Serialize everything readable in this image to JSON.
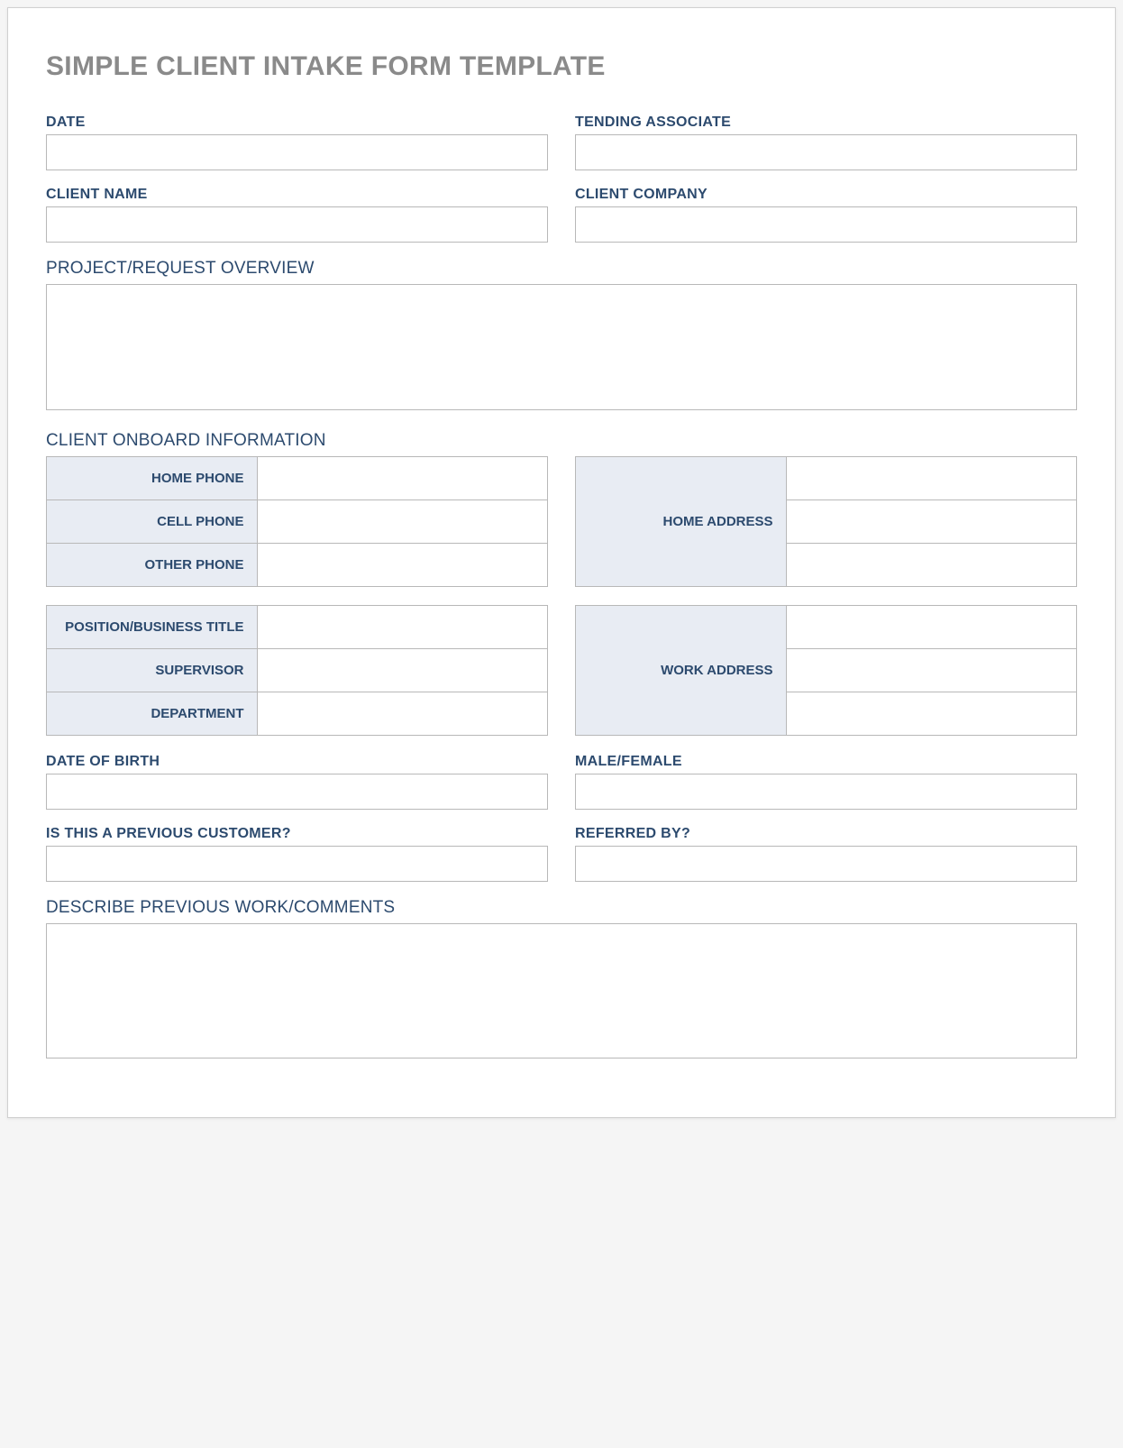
{
  "title": "SIMPLE CLIENT INTAKE FORM TEMPLATE",
  "fields": {
    "date_label": "DATE",
    "date_value": "",
    "tending_associate_label": "TENDING ASSOCIATE",
    "tending_associate_value": "",
    "client_name_label": "CLIENT NAME",
    "client_name_value": "",
    "client_company_label": "CLIENT COMPANY",
    "client_company_value": "",
    "project_overview_label": "PROJECT/REQUEST OVERVIEW",
    "project_overview_value": "",
    "onboard_section_label": "CLIENT ONBOARD INFORMATION",
    "home_phone_label": "HOME PHONE",
    "home_phone_value": "",
    "cell_phone_label": "CELL PHONE",
    "cell_phone_value": "",
    "other_phone_label": "OTHER PHONE",
    "other_phone_value": "",
    "home_address_label": "HOME ADDRESS",
    "home_address_1": "",
    "home_address_2": "",
    "home_address_3": "",
    "position_title_label": "POSITION/BUSINESS TITLE",
    "position_title_value": "",
    "supervisor_label": "SUPERVISOR",
    "supervisor_value": "",
    "department_label": "DEPARTMENT",
    "department_value": "",
    "work_address_label": "WORK ADDRESS",
    "work_address_1": "",
    "work_address_2": "",
    "work_address_3": "",
    "dob_label": "DATE OF BIRTH",
    "dob_value": "",
    "gender_label": "MALE/FEMALE",
    "gender_value": "",
    "previous_customer_label": "IS THIS A PREVIOUS CUSTOMER?",
    "previous_customer_value": "",
    "referred_by_label": "REFERRED BY?",
    "referred_by_value": "",
    "comments_label": "DESCRIBE PREVIOUS WORK/COMMENTS",
    "comments_value": ""
  }
}
